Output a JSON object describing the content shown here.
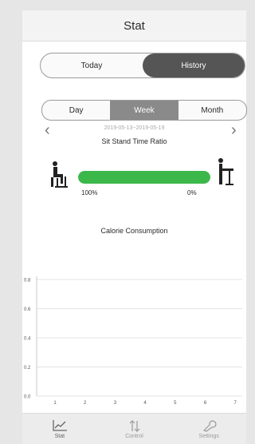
{
  "header": {
    "title": "Stat"
  },
  "view_toggle": {
    "today": "Today",
    "history": "History",
    "selected": "History"
  },
  "period_toggle": {
    "day": "Day",
    "week": "Week",
    "month": "Month",
    "selected": "Week"
  },
  "date_range": "2019-05-13~2019-05-19",
  "ratio": {
    "title": "Sit Stand Time Ratio",
    "sit_label": "100%",
    "stand_label": "0%",
    "sit_fraction": 1.0,
    "fill_color": "#3cb84a"
  },
  "calorie": {
    "title": "Calorie Consumption"
  },
  "chart_data": {
    "type": "line",
    "x": [
      1,
      2,
      3,
      4,
      5,
      6,
      7
    ],
    "y_ticks": [
      "0.8",
      "0.6",
      "0.4",
      "0.2",
      "0.0"
    ],
    "ylim": [
      0,
      0.8
    ],
    "series": [],
    "grid": true
  },
  "footer": {
    "tabs": [
      {
        "label": "Stat",
        "icon": "chart-line-icon",
        "active": true
      },
      {
        "label": "Control",
        "icon": "up-down-arrows-icon",
        "active": false
      },
      {
        "label": "Settings",
        "icon": "wrench-icon",
        "active": false
      }
    ]
  }
}
